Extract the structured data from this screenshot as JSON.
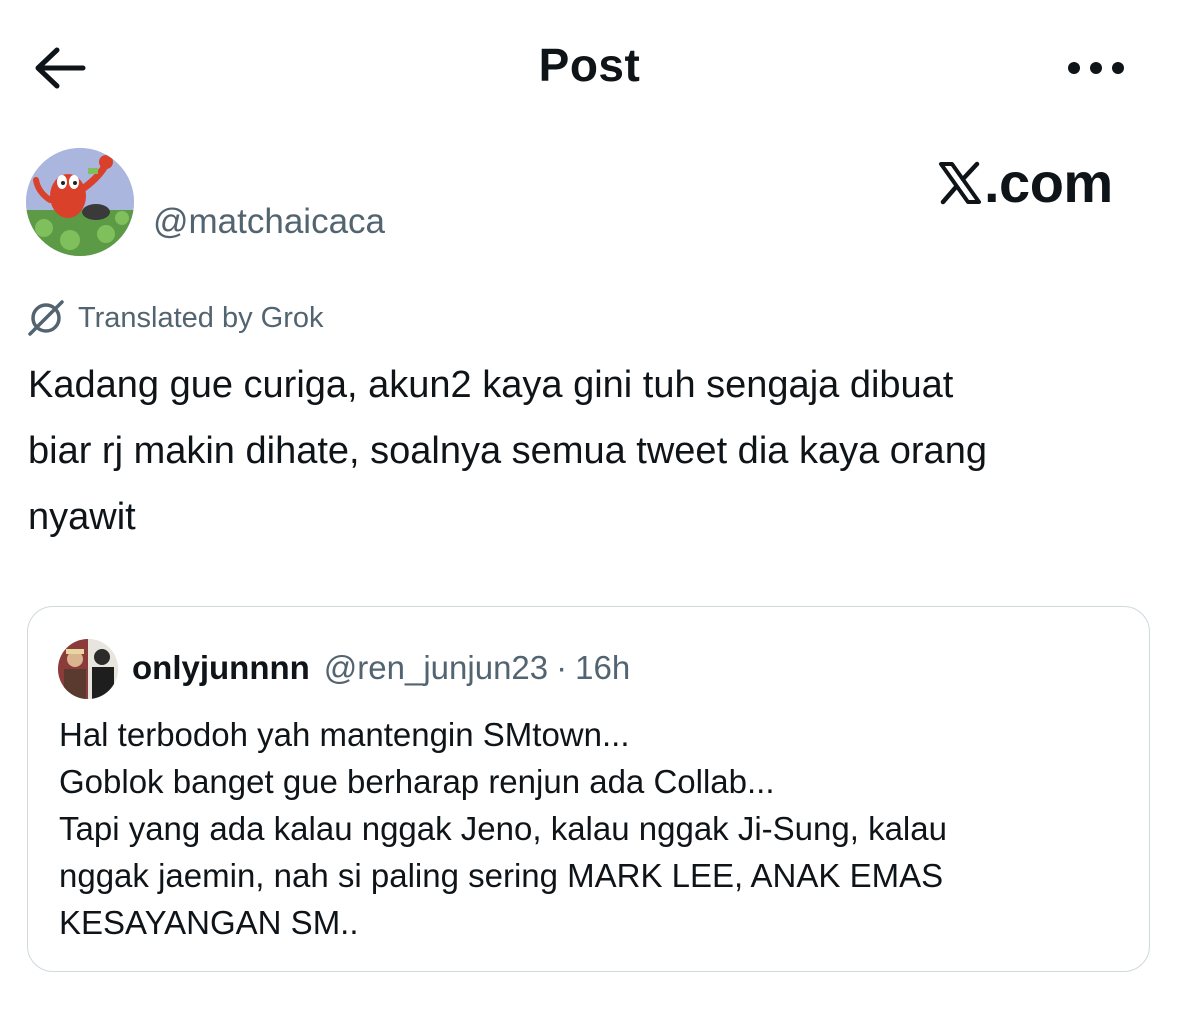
{
  "header": {
    "title": "Post",
    "back_icon": "arrow-left-icon",
    "more_icon": "more-horizontal-icon"
  },
  "author": {
    "handle": "@matchaicaca",
    "avatar_icon": "avatar-cartoon-crab"
  },
  "brand": {
    "label": ".com",
    "icon": "x-logo-icon"
  },
  "translation": {
    "label": "Translated by Grok",
    "icon": "grok-icon"
  },
  "post": {
    "lines": [
      "Kadang gue curiga, akun2 kaya gini tuh sengaja dibuat",
      "biar rj makin dihate, soalnya semua tweet dia kaya orang",
      "nyawit"
    ]
  },
  "quote": {
    "display_name": "onlyjunnnn",
    "handle": "@ren_junjun23",
    "separator": "·",
    "time": "16h",
    "lines": [
      "Hal terbodoh yah mantengin SMtown...",
      "Goblok banget gue berharap renjun ada Collab...",
      "Tapi yang ada kalau nggak Jeno, kalau nggak Ji-Sung, kalau",
      "nggak jaemin, nah si paling sering MARK LEE, ANAK EMAS",
      "KESAYANGAN SM.."
    ]
  },
  "colors": {
    "text": "#0f1419",
    "secondary": "#536471",
    "border": "#cfd9de"
  }
}
